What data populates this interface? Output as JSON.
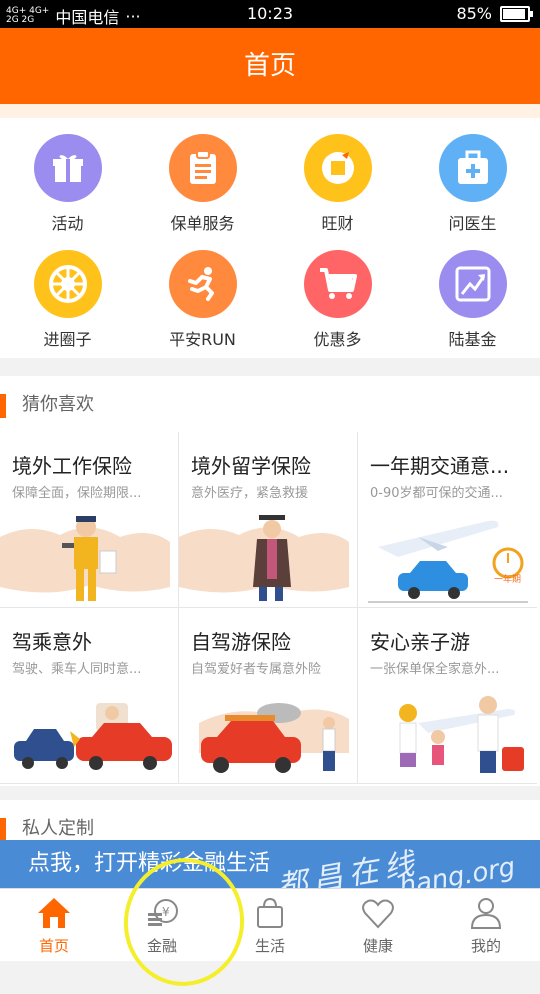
{
  "status_bar": {
    "signal": "4G+ 4G+\n2G 2G",
    "carrier": "中国电信",
    "more": "···",
    "time": "10:23",
    "battery": "85%",
    "battery_level": 0.85
  },
  "header": {
    "title": "首页"
  },
  "icons": [
    {
      "label": "活动",
      "icon": "gift-icon",
      "color": "#9b8cf0"
    },
    {
      "label": "保单服务",
      "icon": "clipboard-icon",
      "color": "#ff8a3d"
    },
    {
      "label": "旺财",
      "icon": "coin-icon",
      "color": "#ffc21a"
    },
    {
      "label": "问医生",
      "icon": "medical-kit-icon",
      "color": "#5fb0f5"
    },
    {
      "label": "进圈子",
      "icon": "wheel-icon",
      "color": "#ffc21a"
    },
    {
      "label": "平安RUN",
      "icon": "runner-icon",
      "color": "#ff8a3d"
    },
    {
      "label": "优惠多",
      "icon": "cart-icon",
      "color": "#ff6566"
    },
    {
      "label": "陆基金",
      "icon": "chart-up-icon",
      "color": "#9b8cf0"
    }
  ],
  "section_guess": {
    "title": "猜你喜欢"
  },
  "cards": [
    {
      "title": "境外工作保险",
      "subtitle": "保障全面，保险期限..."
    },
    {
      "title": "境外留学保险",
      "subtitle": "意外医疗，紧急救援"
    },
    {
      "title": "一年期交通意...",
      "subtitle": "0-90岁都可保的交通...",
      "badge": "一年期"
    },
    {
      "title": "驾乘意外",
      "subtitle": "驾驶、乘车人同时意..."
    },
    {
      "title": "自驾游保险",
      "subtitle": "自驾爱好者专属意外险"
    },
    {
      "title": "安心亲子游",
      "subtitle": "一张保单保全家意外..."
    }
  ],
  "section_private": {
    "title": "私人定制"
  },
  "banner": {
    "text": "点我，打开精彩金融生活",
    "watermark_cn": "都昌在线",
    "watermark_en": "hang.org"
  },
  "tabs": [
    {
      "label": "首页",
      "icon": "home-icon",
      "active": true
    },
    {
      "label": "金融",
      "icon": "finance-coins-icon",
      "active": false
    },
    {
      "label": "生活",
      "icon": "shopping-bag-icon",
      "active": false
    },
    {
      "label": "健康",
      "icon": "heart-icon",
      "active": false
    },
    {
      "label": "我的",
      "icon": "user-icon",
      "active": false
    }
  ],
  "colors": {
    "primary": "#ff6600",
    "banner": "#4a8bd6",
    "annotation": "#f5ee2b"
  }
}
